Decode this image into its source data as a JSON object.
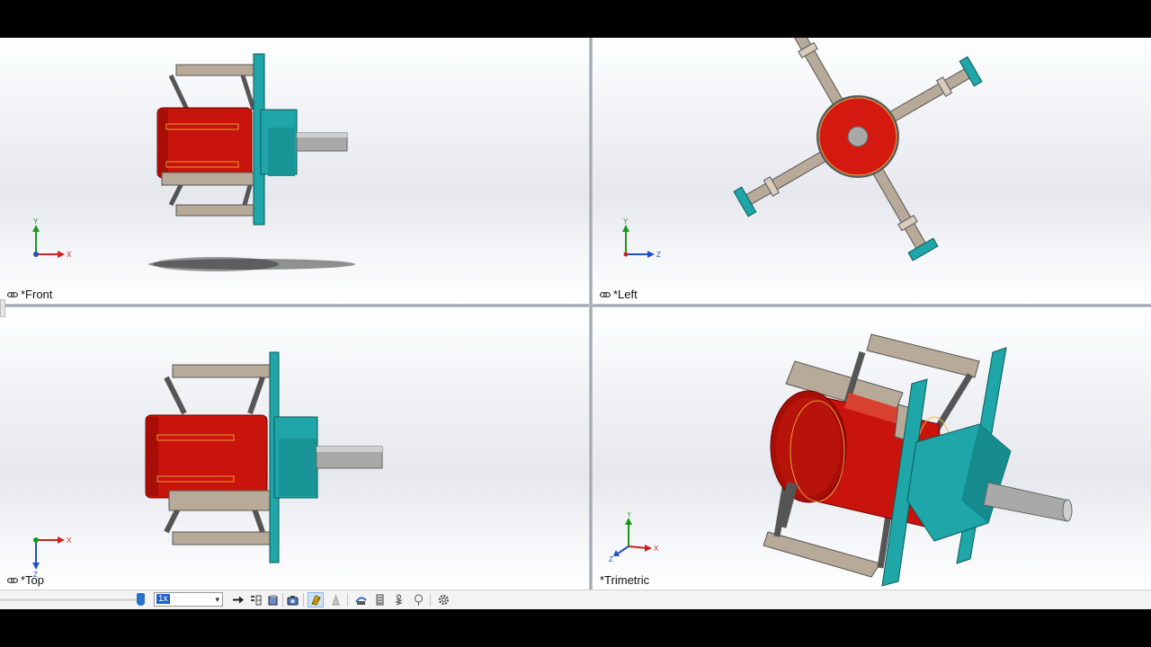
{
  "viewports": {
    "front": {
      "label": "*Front",
      "axes": {
        "vertical": "Y",
        "horizontal": "X"
      }
    },
    "left": {
      "label": "*Left",
      "axes": {
        "vertical": "Y",
        "horizontal": "Z"
      }
    },
    "top": {
      "label": "*Top",
      "axes": {
        "vertical": "Z",
        "horizontal": "X"
      }
    },
    "trimetric": {
      "label": "*Trimetric",
      "axes": {
        "vertical": "Y",
        "horizontal": "X",
        "depth": "Z"
      }
    }
  },
  "toolbar": {
    "zoom_value": "1x",
    "icons": [
      "arrow-right-icon",
      "step-icon",
      "camera-icon",
      "cube-icon",
      "render-icon",
      "light-icon",
      "scene-icon",
      "list-icon",
      "motor-icon",
      "gravity-icon",
      "settings-icon"
    ]
  },
  "colors": {
    "motor_red": "#d41a10",
    "housing_teal": "#1fa6a8",
    "bar_tan": "#b8aa98",
    "shaft_gray": "#a9a9a9",
    "axis_y_green": "#1a9a1a",
    "axis_x_red": "#d02020",
    "axis_z_blue": "#2050c8"
  }
}
